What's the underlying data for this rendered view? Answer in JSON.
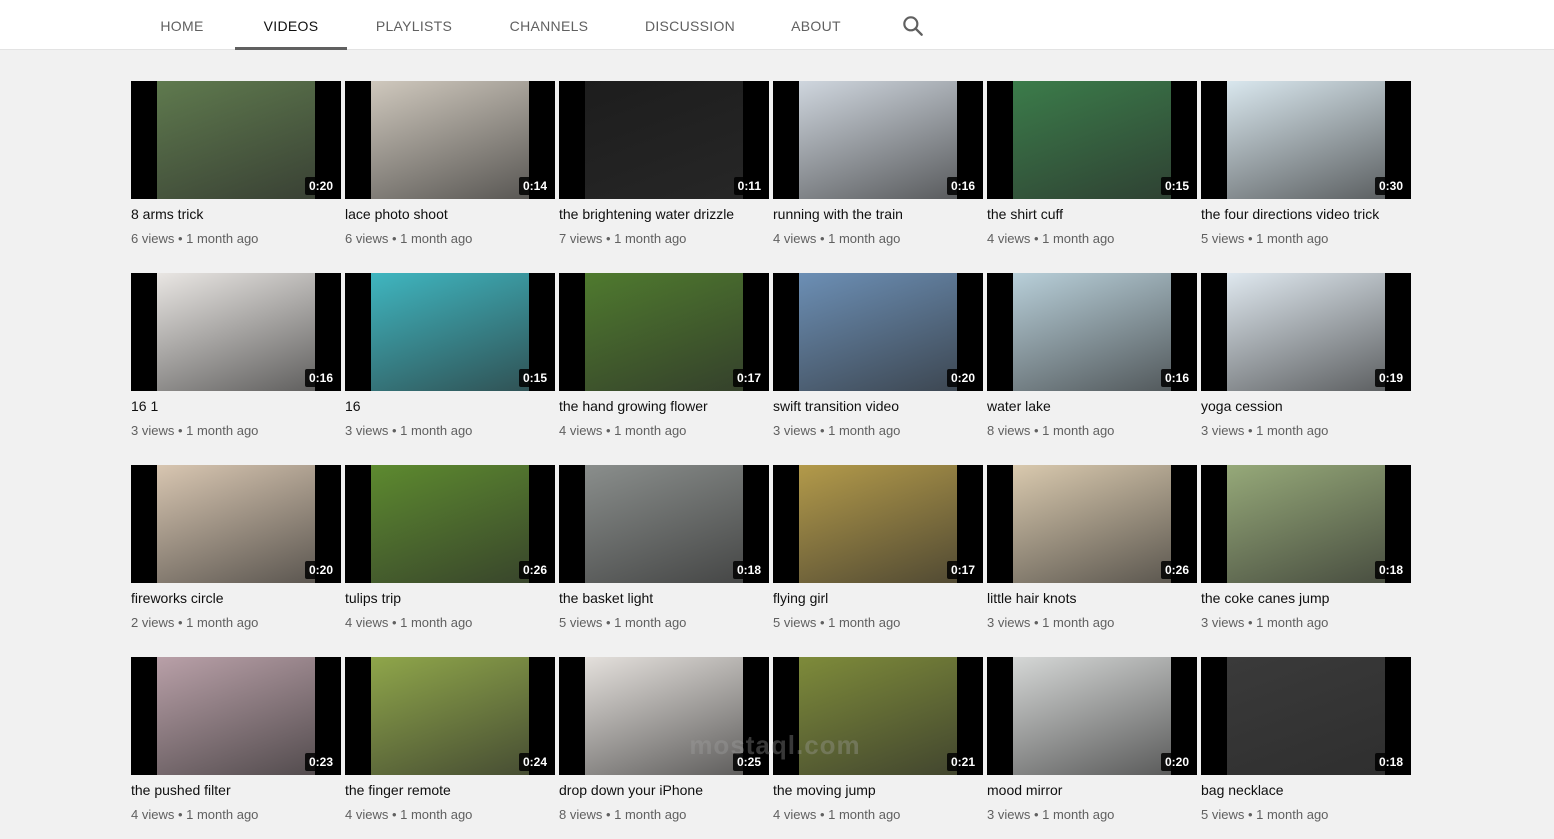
{
  "nav": {
    "tabs": [
      {
        "label": "HOME",
        "active": false
      },
      {
        "label": "VIDEOS",
        "active": true
      },
      {
        "label": "PLAYLISTS",
        "active": false
      },
      {
        "label": "CHANNELS",
        "active": false
      },
      {
        "label": "DISCUSSION",
        "active": false
      },
      {
        "label": "ABOUT",
        "active": false
      }
    ],
    "search_icon": "search-icon"
  },
  "watermark": "mostaql.com",
  "videos": [
    {
      "title": "8 arms trick",
      "duration": "0:20",
      "meta": "6 views • 1 month ago"
    },
    {
      "title": "lace photo shoot",
      "duration": "0:14",
      "meta": "6 views • 1 month ago"
    },
    {
      "title": "the brightening water drizzle",
      "duration": "0:11",
      "meta": "7 views • 1 month ago"
    },
    {
      "title": "running with the train",
      "duration": "0:16",
      "meta": "4 views • 1 month ago"
    },
    {
      "title": "the shirt cuff",
      "duration": "0:15",
      "meta": "4 views • 1 month ago"
    },
    {
      "title": "the four directions video trick",
      "duration": "0:30",
      "meta": "5 views • 1 month ago"
    },
    {
      "title": "16 1",
      "duration": "0:16",
      "meta": "3 views • 1 month ago"
    },
    {
      "title": "16",
      "duration": "0:15",
      "meta": "3 views • 1 month ago"
    },
    {
      "title": "the hand growing flower",
      "duration": "0:17",
      "meta": "4 views • 1 month ago"
    },
    {
      "title": "swift transition video",
      "duration": "0:20",
      "meta": "3 views • 1 month ago"
    },
    {
      "title": "water lake",
      "duration": "0:16",
      "meta": "8 views • 1 month ago"
    },
    {
      "title": "yoga cession",
      "duration": "0:19",
      "meta": "3 views • 1 month ago"
    },
    {
      "title": "fireworks circle",
      "duration": "0:20",
      "meta": "2 views • 1 month ago"
    },
    {
      "title": "tulips trip",
      "duration": "0:26",
      "meta": "4 views • 1 month ago"
    },
    {
      "title": "the basket light",
      "duration": "0:18",
      "meta": "5 views • 1 month ago"
    },
    {
      "title": "flying girl",
      "duration": "0:17",
      "meta": "5 views • 1 month ago"
    },
    {
      "title": "little hair knots",
      "duration": "0:26",
      "meta": "3 views • 1 month ago"
    },
    {
      "title": "the coke canes jump",
      "duration": "0:18",
      "meta": "3 views • 1 month ago"
    },
    {
      "title": "the pushed filter",
      "duration": "0:23",
      "meta": "4 views • 1 month ago"
    },
    {
      "title": "the finger remote",
      "duration": "0:24",
      "meta": "4 views • 1 month ago"
    },
    {
      "title": "drop down your iPhone",
      "duration": "0:25",
      "meta": "8 views • 1 month ago"
    },
    {
      "title": "the moving jump",
      "duration": "0:21",
      "meta": "4 views • 1 month ago"
    },
    {
      "title": "mood mirror",
      "duration": "0:20",
      "meta": "3 views • 1 month ago"
    },
    {
      "title": "bag necklace",
      "duration": "0:18",
      "meta": "5 views • 1 month ago"
    }
  ],
  "colors": {
    "background": "#f1f1f1",
    "header": "#ffffff",
    "title_text": "#0f0f0f",
    "meta_text": "#606060"
  }
}
